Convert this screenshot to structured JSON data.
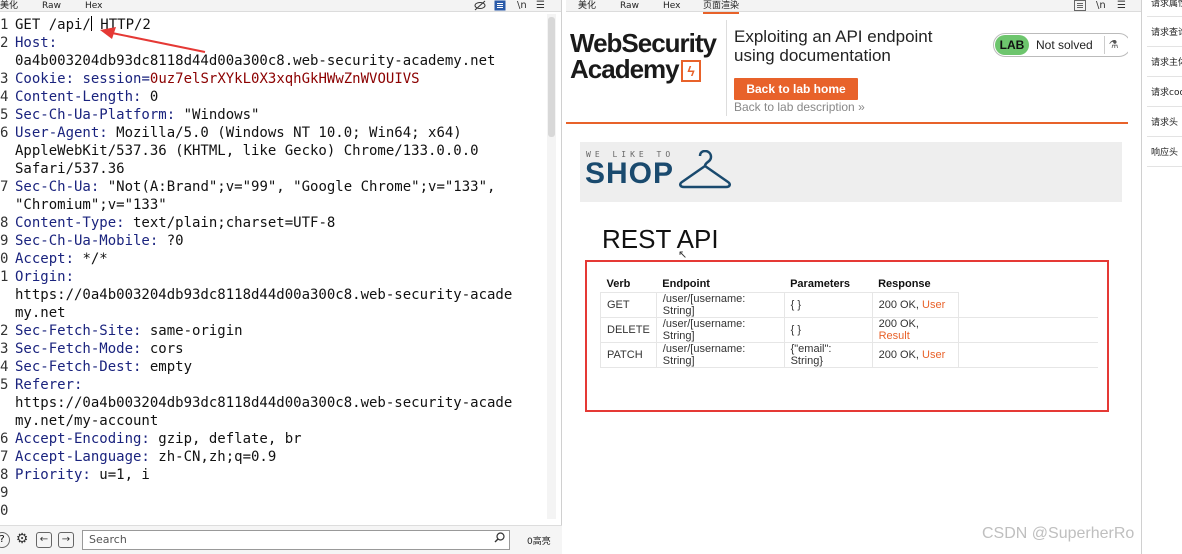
{
  "request": {
    "tabs": [
      "美化",
      "Raw",
      "Hex"
    ],
    "icons": [
      "eye-off-icon",
      "list-icon",
      "newline-icon",
      "menu-icon"
    ],
    "lines": [
      {
        "n": "1",
        "segs": [
          {
            "t": "GET /api/"
          },
          {
            "caret": true
          },
          {
            "t": " HTTP/2"
          }
        ]
      },
      {
        "n": "2",
        "segs": [
          {
            "t": "Host:",
            "c": "key"
          }
        ]
      },
      {
        "n": "",
        "segs": [
          {
            "t": "0a4b003204db93dc8118d44d00a300c8.web-security-academy.net"
          }
        ]
      },
      {
        "n": "3",
        "segs": [
          {
            "t": "Cookie: ",
            "c": "key"
          },
          {
            "t": "session",
            "c": "key"
          },
          {
            "t": "=",
            "c": "key"
          },
          {
            "t": "0uz7elSrXYkL0X3xqhGkHWwZnWVOUIVS",
            "c": "cookie"
          }
        ]
      },
      {
        "n": "4",
        "segs": [
          {
            "t": "Content-Length:",
            "c": "key"
          },
          {
            "t": " 0"
          }
        ]
      },
      {
        "n": "5",
        "segs": [
          {
            "t": "Sec-Ch-Ua-Platform:",
            "c": "key"
          },
          {
            "t": " \"Windows\""
          }
        ]
      },
      {
        "n": "6",
        "segs": [
          {
            "t": "User-Agent:",
            "c": "key"
          },
          {
            "t": " Mozilla/5.0 (Windows NT 10.0; Win64; x64)"
          }
        ]
      },
      {
        "n": "",
        "segs": [
          {
            "t": "AppleWebKit/537.36 (KHTML, like Gecko) Chrome/133.0.0.0"
          }
        ]
      },
      {
        "n": "",
        "segs": [
          {
            "t": "Safari/537.36"
          }
        ]
      },
      {
        "n": "7",
        "segs": [
          {
            "t": "Sec-Ch-Ua:",
            "c": "key"
          },
          {
            "t": " \"Not(A:Brand\";v=\"99\", \"Google Chrome\";v=\"133\","
          }
        ]
      },
      {
        "n": "",
        "segs": [
          {
            "t": "\"Chromium\";v=\"133\""
          }
        ]
      },
      {
        "n": "8",
        "segs": [
          {
            "t": "Content-Type:",
            "c": "key"
          },
          {
            "t": " text/plain;charset=UTF-8"
          }
        ]
      },
      {
        "n": "9",
        "segs": [
          {
            "t": "Sec-Ch-Ua-Mobile:",
            "c": "key"
          },
          {
            "t": " ?0"
          }
        ]
      },
      {
        "n": "0",
        "segs": [
          {
            "t": "Accept:",
            "c": "key"
          },
          {
            "t": " */*"
          }
        ]
      },
      {
        "n": "1",
        "segs": [
          {
            "t": "Origin:",
            "c": "key"
          }
        ]
      },
      {
        "n": "",
        "segs": [
          {
            "t": "https://0a4b003204db93dc8118d44d00a300c8.web-security-acade"
          }
        ]
      },
      {
        "n": "",
        "segs": [
          {
            "t": "my.net"
          }
        ]
      },
      {
        "n": "2",
        "segs": [
          {
            "t": "Sec-Fetch-Site:",
            "c": "key"
          },
          {
            "t": " same-origin"
          }
        ]
      },
      {
        "n": "3",
        "segs": [
          {
            "t": "Sec-Fetch-Mode:",
            "c": "key"
          },
          {
            "t": " cors"
          }
        ]
      },
      {
        "n": "4",
        "segs": [
          {
            "t": "Sec-Fetch-Dest:",
            "c": "key"
          },
          {
            "t": " empty"
          }
        ]
      },
      {
        "n": "5",
        "segs": [
          {
            "t": "Referer:",
            "c": "key"
          }
        ]
      },
      {
        "n": "",
        "segs": [
          {
            "t": "https://0a4b003204db93dc8118d44d00a300c8.web-security-acade"
          }
        ]
      },
      {
        "n": "",
        "segs": [
          {
            "t": "my.net/my-account"
          }
        ]
      },
      {
        "n": "6",
        "segs": [
          {
            "t": "Accept-Encoding:",
            "c": "key"
          },
          {
            "t": " gzip, deflate, br"
          }
        ]
      },
      {
        "n": "7",
        "segs": [
          {
            "t": "Accept-Language:",
            "c": "key"
          },
          {
            "t": " zh-CN,zh;q=0.9"
          }
        ]
      },
      {
        "n": "8",
        "segs": [
          {
            "t": "Priority:",
            "c": "key"
          },
          {
            "t": " u=1, i"
          }
        ]
      },
      {
        "n": "9",
        "segs": []
      },
      {
        "n": "0",
        "segs": []
      }
    ],
    "search_placeholder": "Search",
    "matches": "0高亮"
  },
  "response": {
    "tabs": [
      "美化",
      "Raw",
      "Hex",
      "页面渲染"
    ],
    "active_tab": "页面渲染",
    "icons": [
      "list-icon",
      "newline-icon",
      "menu-icon"
    ],
    "logo_line1": "WebSecurity",
    "logo_line2": "Academy",
    "logo_bolt": "ϟ",
    "lab_title": "Exploiting an API endpoint using documentation",
    "back_button": "Back to lab home",
    "back_desc": "Back to lab description",
    "back_desc_chevron": "»",
    "lab_badge": "LAB",
    "status": "Not solved",
    "flask_icon": "⚗",
    "shop_tagline": "WE LIKE TO",
    "shop_name": "SHOP",
    "api_title": "REST API",
    "table": {
      "headers": [
        "Verb",
        "Endpoint",
        "Parameters",
        "Response"
      ],
      "rows": [
        {
          "verb": "GET",
          "endpoint": "/user/[username: String]",
          "params": "{ }",
          "resp_code": "200 OK, ",
          "resp_link": "User"
        },
        {
          "verb": "DELETE",
          "endpoint": "/user/[username: String]",
          "params": "{ }",
          "resp_code": "200 OK, ",
          "resp_link": "Result"
        },
        {
          "verb": "PATCH",
          "endpoint": "/user/[username: String]",
          "params": "{\"email\": String}",
          "resp_code": "200 OK, ",
          "resp_link": "User"
        }
      ]
    }
  },
  "side": {
    "items": [
      "请求属性",
      "请求查询参数",
      "请求主体参数",
      "请求cookie",
      "请求头",
      "响应头"
    ]
  },
  "watermark": "CSDN @SuperherRo",
  "colors": {
    "accent": "#e8622a",
    "annotation": "#e53935",
    "header_key": "#1a237e",
    "cookie_value": "#8b0000"
  }
}
